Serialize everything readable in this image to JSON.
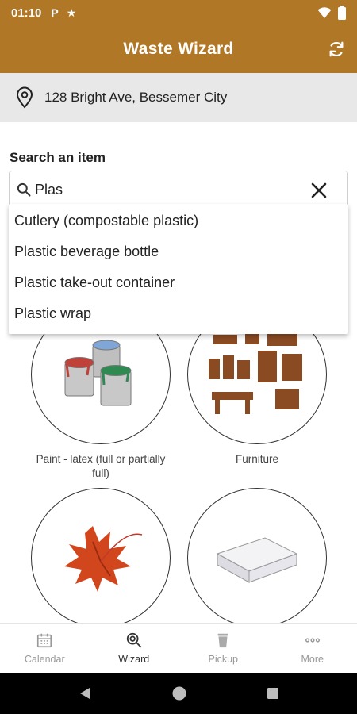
{
  "status_bar": {
    "time": "01:10",
    "icon1": "P",
    "icon2": "★"
  },
  "app_bar": {
    "title": "Waste Wizard",
    "refresh_icon": "refresh-icon"
  },
  "address": {
    "text": "128 Bright Ave, Bessemer City",
    "icon": "location-pin-icon"
  },
  "search": {
    "label": "Search an item",
    "value": "Plas",
    "placeholder": ""
  },
  "suggestions": [
    "Cutlery (compostable plastic)",
    "Plastic beverage bottle",
    "Plastic take-out container",
    "Plastic wrap"
  ],
  "grid": [
    {
      "label": "Paint - latex (full or partially full)"
    },
    {
      "label": "Furniture"
    },
    {
      "label": ""
    },
    {
      "label": ""
    }
  ],
  "bottom_nav": [
    {
      "label": "Calendar",
      "icon": "calendar-icon",
      "active": false
    },
    {
      "label": "Wizard",
      "icon": "wizard-search-icon",
      "active": true
    },
    {
      "label": "Pickup",
      "icon": "trash-can-icon",
      "active": false
    },
    {
      "label": "More",
      "icon": "more-dots-icon",
      "active": false
    }
  ],
  "colors": {
    "brand": "#b07727",
    "address_bg": "#e8e8e8"
  }
}
